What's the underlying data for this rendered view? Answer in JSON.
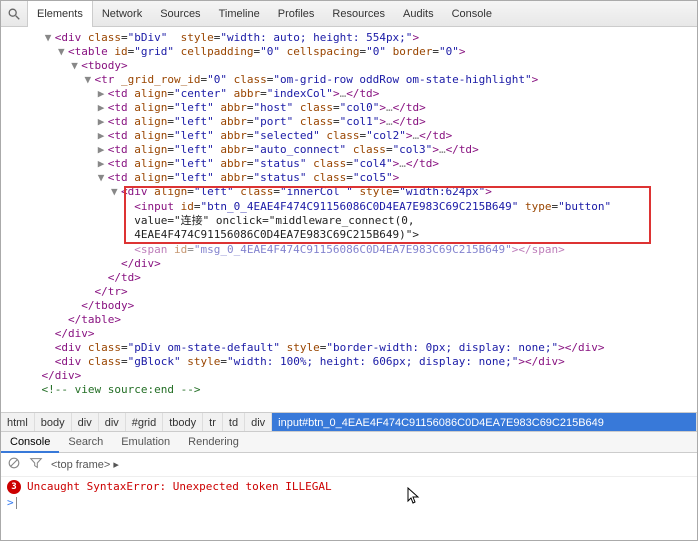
{
  "toolbar": {
    "tabs": [
      "Elements",
      "Network",
      "Sources",
      "Timeline",
      "Profiles",
      "Resources",
      "Audits",
      "Console"
    ],
    "active": 0
  },
  "tree": {
    "lines": [
      {
        "indent": 3,
        "tri": "▼",
        "html": "<div class=\"bDiv\"  style=\"width: auto; height: 554px;\">"
      },
      {
        "indent": 4,
        "tri": "▼",
        "html": "<table id=\"grid\" cellpadding=\"0\" cellspacing=\"0\" border=\"0\">"
      },
      {
        "indent": 5,
        "tri": "▼",
        "html": "<tbody>"
      },
      {
        "indent": 6,
        "tri": "▼",
        "html": "<tr _grid_row_id=\"0\" class=\"om-grid-row oddRow om-state-highlight\">"
      },
      {
        "indent": 7,
        "tri": "▶",
        "html": "<td align=\"center\" abbr=\"indexCol\">…</td>"
      },
      {
        "indent": 7,
        "tri": "▶",
        "html": "<td align=\"left\" abbr=\"host\" class=\"col0\">…</td>"
      },
      {
        "indent": 7,
        "tri": "▶",
        "html": "<td align=\"left\" abbr=\"port\" class=\"col1\">…</td>"
      },
      {
        "indent": 7,
        "tri": "▶",
        "html": "<td align=\"left\" abbr=\"selected\" class=\"col2\">…</td>"
      },
      {
        "indent": 7,
        "tri": "▶",
        "html": "<td align=\"left\" abbr=\"auto_connect\" class=\"col3\">…</td>"
      },
      {
        "indent": 7,
        "tri": "▶",
        "html": "<td align=\"left\" abbr=\"status\" class=\"col4\">…</td>"
      },
      {
        "indent": 7,
        "tri": "▼",
        "html": "<td align=\"left\" abbr=\"status\" class=\"col5\">"
      },
      {
        "indent": 8,
        "tri": "▼",
        "html": "<div align=\"left\" class=\"innerCol \" style=\"width:624px\">"
      },
      {
        "indent": 9,
        "tri": "",
        "boxed": true,
        "multi": [
          "<input id=\"btn_0_4EAE4F474C91156086C0D4EA7E983C69C215B649\" type=\"button\"",
          "value=\"连接\" onclick=\"middleware_connect(0,",
          "4EAE4F474C91156086C0D4EA7E983C69C215B649)\">"
        ]
      },
      {
        "indent": 9,
        "tri": "",
        "html": "<span id=\"msg_0_4EAE4F474C91156086C0D4EA7E983C69C215B649\"></span>",
        "faded": true
      },
      {
        "indent": 8,
        "tri": "",
        "close": "</div>"
      },
      {
        "indent": 7,
        "tri": "",
        "close": "</td>"
      },
      {
        "indent": 6,
        "tri": "",
        "close": "</tr>"
      },
      {
        "indent": 5,
        "tri": "",
        "close": "</tbody>"
      },
      {
        "indent": 4,
        "tri": "",
        "close": "</table>"
      },
      {
        "indent": 3,
        "tri": "",
        "close": "</div>"
      },
      {
        "indent": 3,
        "tri": "",
        "html": "<div class=\"pDiv om-state-default\" style=\"border-width: 0px; display: none;\"></div>"
      },
      {
        "indent": 3,
        "tri": "",
        "html": "<div class=\"gBlock\" style=\"width: 100%; height: 606px; display: none;\"></div>"
      },
      {
        "indent": 2,
        "tri": "",
        "close": "</div>"
      },
      {
        "indent": 2,
        "tri": "",
        "comment": "<!-- view source:end -->"
      }
    ]
  },
  "breadcrumb": {
    "items": [
      "html",
      "body",
      "div",
      "div",
      "#grid",
      "tbody",
      "tr",
      "td",
      "div"
    ],
    "selected": "input#btn_0_4EAE4F474C91156086C0D4EA7E983C69C215B649"
  },
  "console_tabs": {
    "items": [
      "Console",
      "Search",
      "Emulation",
      "Rendering"
    ],
    "active": 0
  },
  "frame_selector": "<top frame>",
  "error": {
    "count": "3",
    "message": "Uncaught SyntaxError: Unexpected token ILLEGAL"
  },
  "prompt": ">"
}
